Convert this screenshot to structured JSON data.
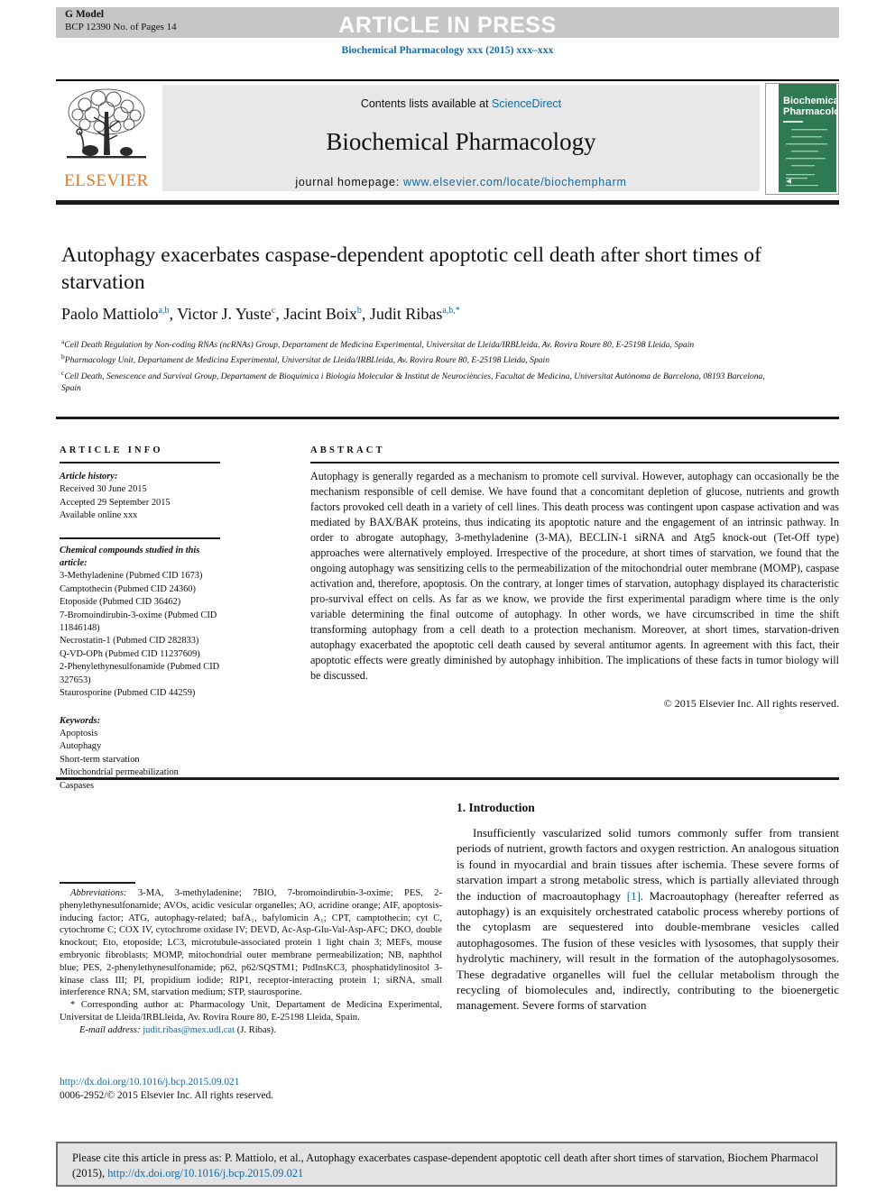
{
  "banner": {
    "g_model": "G Model",
    "article_id": "BCP 12390 No. of Pages 14",
    "press_label": "ARTICLE IN PRESS",
    "journal_ref": "Biochemical Pharmacology xxx (2015) xxx–xxx"
  },
  "masthead": {
    "contents_prefix": "Contents lists available at ",
    "contents_link": "ScienceDirect",
    "journal_name": "Biochemical Pharmacology",
    "homepage_prefix": "journal homepage: ",
    "homepage_url": "www.elsevier.com/locate/biochempharm",
    "publisher_logo_text": "ELSEVIER",
    "cover_title_line1": "Biochemical",
    "cover_title_line2": "Pharmacology"
  },
  "article": {
    "title": "Autophagy exacerbates caspase-dependent apoptotic cell death after short times of starvation",
    "authors_plain": "Paolo Mattiolo a,b, Victor J. Yuste c, Jacint Boix b, Judit Ribas a,b,*",
    "authors": [
      {
        "name": "Paolo Mattiolo",
        "marks": "a,b"
      },
      {
        "name": "Victor J. Yuste",
        "marks": "c"
      },
      {
        "name": "Jacint Boix",
        "marks": "b"
      },
      {
        "name": "Judit Ribas",
        "marks": "a,b,*"
      }
    ],
    "affiliations": [
      {
        "mark": "a",
        "text": "Cell Death Regulation by Non-coding RNAs (ncRNAs) Group, Departament de Medicina Experimental, Universitat de Lleida/IRBLleida, Av. Rovira Roure 80, E-25198 Lleida, Spain"
      },
      {
        "mark": "b",
        "text": "Pharmacology Unit, Departament de Medicina Experimental, Universitat de Lleida/IRBLleida, Av. Rovira Roure 80, E-25198 Lleida, Spain"
      },
      {
        "mark": "c",
        "text": "Cell Death, Senescence and Survival Group, Departament de Bioquímica i Biologia Molecular & Institut de Neurociències, Facultat de Medicina, Universitat Autònoma de Barcelona, 08193 Barcelona, Spain"
      }
    ]
  },
  "article_info": {
    "heading": "ARTICLE INFO",
    "history_label": "Article history:",
    "history": [
      "Received 30 June 2015",
      "Accepted 29 September 2015",
      "Available online xxx"
    ],
    "compounds_label": "Chemical compounds studied in this article:",
    "compounds": [
      "3-Methyladenine (Pubmed CID 1673)",
      "Camptothecin (Pubmed CID 24360)",
      "Etoposide (Pubmed CID 36462)",
      "7-Bromoindirubin-3-oxime (Pubmed CID 11846148)",
      "Necrostatin-1 (Pubmed CID 282833)",
      "Q-VD-OPh (Pubmed CID 11237609)",
      "2-Phenylethynesulfonamide (Pubmed CID 327653)",
      "Staurosporine (Pubmed CID 44259)"
    ],
    "keywords_label": "Keywords:",
    "keywords": [
      "Apoptosis",
      "Autophagy",
      "Short-term starvation",
      "Mitochondrial permeabilization",
      "Caspases"
    ]
  },
  "abstract": {
    "heading": "ABSTRACT",
    "body": "Autophagy is generally regarded as a mechanism to promote cell survival. However, autophagy can occasionally be the mechanism responsible of cell demise. We have found that a concomitant depletion of glucose, nutrients and growth factors provoked cell death in a variety of cell lines. This death process was contingent upon caspase activation and was mediated by BAX/BAK proteins, thus indicating its apoptotic nature and the engagement of an intrinsic pathway. In order to abrogate autophagy, 3-methyladenine (3-MA), BECLIN-1 siRNA and Atg5 knock-out (Tet-Off type) approaches were alternatively employed. Irrespective of the procedure, at short times of starvation, we found that the ongoing autophagy was sensitizing cells to the permeabilization of the mitochondrial outer membrane (MOMP), caspase activation and, therefore, apoptosis. On the contrary, at longer times of starvation, autophagy displayed its characteristic pro-survival effect on cells. As far as we know, we provide the first experimental paradigm where time is the only variable determining the final outcome of autophagy. In other words, we have circumscribed in time the shift transforming autophagy from a cell death to a protection mechanism. Moreover, at short times, starvation-driven autophagy exacerbated the apoptotic cell death caused by several antitumor agents. In agreement with this fact, their apoptotic effects were greatly diminished by autophagy inhibition. The implications of these facts in tumor biology will be discussed.",
    "copyright": "© 2015 Elsevier Inc. All rights reserved."
  },
  "introduction": {
    "heading": "1. Introduction",
    "para_part1": "Insufficiently vascularized solid tumors commonly suffer from transient periods of nutrient, growth factors and oxygen restriction. An analogous situation is found in myocardial and brain tissues after ischemia. These severe forms of starvation impart a strong metabolic stress, which is partially alleviated through the induction of macroautophagy ",
    "citation": "[1]",
    "para_part2": ". Macroautophagy (hereafter referred as autophagy) is an exquisitely orchestrated catabolic process whereby portions of the cytoplasm are sequestered into double-membrane vesicles called autophagosomes. The fusion of these vesicles with lysosomes, that supply their hydrolytic machinery, will result in the formation of the autophagolysosomes. These degradative organelles will fuel the cellular metabolism through the recycling of biomolecules and, indirectly, contributing to the bioenergetic management. Severe forms of starvation"
  },
  "footnotes": {
    "abbrev_label": "Abbreviations:",
    "abbrev_text": " 3-MA, 3-methyladenine; 7BIO, 7-bromoindirubin-3-oxime; PES, 2-phenylethynesulfonamide; AVOs, acidic vesicular organelles; AO, acridine orange; AIF, apoptosis-inducing factor; ATG, autophagy-related; bafA₁, bafylomicin A₁; CPT, camptothecin; cyt C, cytochrome C; COX IV, cytochrome oxidase IV; DEVD, Ac-Asp-Glu-Val-Asp-AFC; DKO, double knockout; Eto, etoposide; LC3, microtubule-associated protein 1 light chain 3; MEFs, mouse embryonic fibroblasts; MOMP, mitochondrial outer membrane permeabilization; NB, naphthol blue; PES, 2-phenylethynesulfonamide; p62, p62/SQSTM1; PtdInsKC3, phosphatidylinositol 3-kinase class III; PI, propidium iodide; RIP1, receptor-interacting protein 1; siRNA, small interference RNA; SM, starvation medium; STP, staurosporine.",
    "corresponding_mark": "*",
    "corresponding_text": " Corresponding author at: Pharmacology Unit, Departament de Medicina Experimental, Universitat de Lleida/IRBLleida, Av. Rovira Roure 80, E-25198 Lleida, Spain.",
    "email_label": "E-mail address:",
    "email": "judit.ribas@mex.udl.cat",
    "email_suffix": " (J. Ribas)."
  },
  "doi_block": {
    "doi_url": "http://dx.doi.org/10.1016/j.bcp.2015.09.021",
    "issn_line": "0006-2952/© 2015 Elsevier Inc. All rights reserved."
  },
  "cite_box": {
    "text_part1": "Please cite this article in press as: P. Mattiolo, et al., Autophagy exacerbates caspase-dependent apoptotic cell death after short times of starvation, Biochem Pharmacol (2015), ",
    "doi": "http://dx.doi.org/10.1016/j.bcp.2015.09.021"
  },
  "colors": {
    "link_blue": "#1368a8",
    "banner_gray": "#c6c6c6",
    "masthead_gray": "#e8e8e8",
    "cite_gray": "#e3e3e3",
    "elsevier_orange": "#e87722",
    "cover_green": "#2f7a53"
  }
}
